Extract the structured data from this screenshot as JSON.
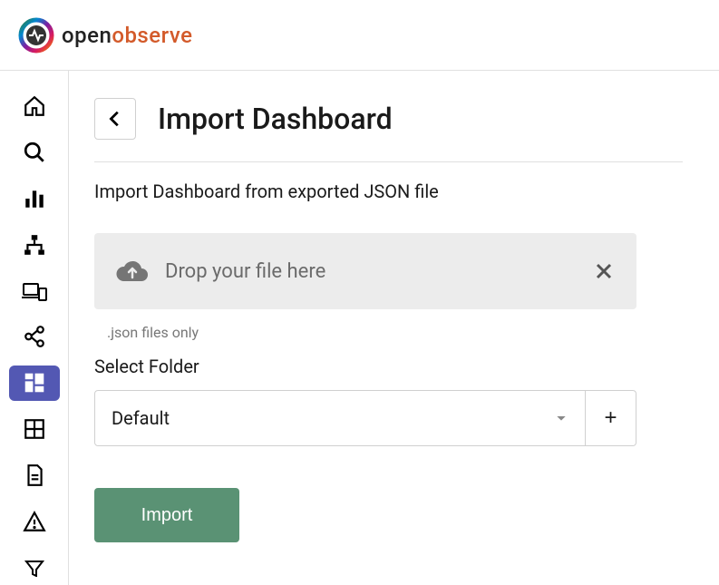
{
  "brand": {
    "name_part1": "open",
    "name_part2": "observe"
  },
  "sidebar": {
    "items": [
      {
        "name": "home"
      },
      {
        "name": "search"
      },
      {
        "name": "logs"
      },
      {
        "name": "traces"
      },
      {
        "name": "devices"
      },
      {
        "name": "pipelines"
      },
      {
        "name": "dashboards",
        "active": true
      },
      {
        "name": "metrics"
      },
      {
        "name": "reports"
      },
      {
        "name": "alerts"
      },
      {
        "name": "filters"
      }
    ]
  },
  "page": {
    "title": "Import Dashboard",
    "subtitle": "Import Dashboard from exported JSON file"
  },
  "dropzone": {
    "placeholder": "Drop your file here",
    "hint": ".json files only"
  },
  "folder": {
    "label": "Select Folder",
    "selected": "Default",
    "add_label": "+"
  },
  "actions": {
    "import_label": "Import"
  }
}
